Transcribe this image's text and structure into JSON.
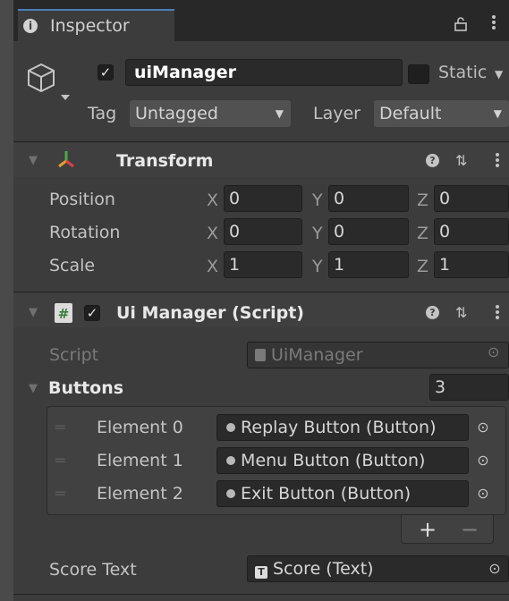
{
  "tab": {
    "title": "Inspector"
  },
  "gameobject": {
    "active": true,
    "name": "uiManager",
    "static_label": "Static",
    "tag_label": "Tag",
    "tag_value": "Untagged",
    "layer_label": "Layer",
    "layer_value": "Default"
  },
  "transform": {
    "title": "Transform",
    "rows": [
      {
        "label": "Position",
        "x": "0",
        "y": "0",
        "z": "0"
      },
      {
        "label": "Rotation",
        "x": "0",
        "y": "0",
        "z": "0"
      },
      {
        "label": "Scale",
        "x": "1",
        "y": "1",
        "z": "1"
      }
    ]
  },
  "axes": {
    "x": "X",
    "y": "Y",
    "z": "Z"
  },
  "script_component": {
    "enabled": true,
    "title": "Ui Manager (Script)",
    "script_label": "Script",
    "script_value": "UiManager",
    "buttons_label": "Buttons",
    "buttons_count": "3",
    "elements": [
      {
        "label": "Element 0",
        "value": "Replay Button (Button)"
      },
      {
        "label": "Element 1",
        "value": "Menu Button (Button)"
      },
      {
        "label": "Element 2",
        "value": "Exit Button (Button)"
      }
    ],
    "add_label": "+",
    "remove_label": "−",
    "score_text_label": "Score Text",
    "score_text_value": "Score (Text)"
  }
}
